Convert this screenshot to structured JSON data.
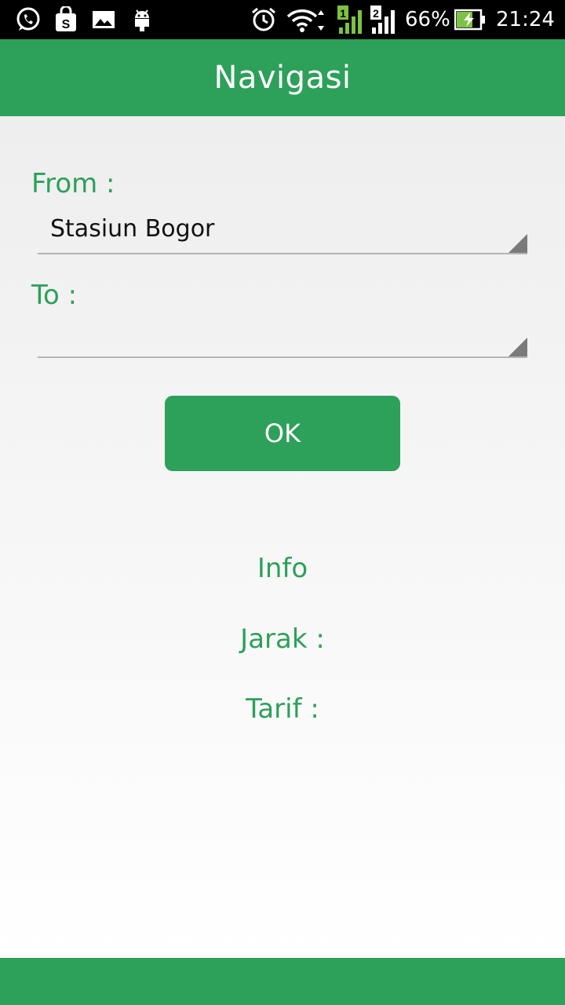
{
  "status_bar": {
    "battery": "66%",
    "time": "21:24",
    "sim1": "1",
    "sim2": "2",
    "icons": [
      "whatsapp-icon",
      "shopping-bag-icon",
      "gallery-icon",
      "android-icon",
      "alarm-icon",
      "wifi-icon",
      "signal-icon",
      "battery-charging-icon"
    ]
  },
  "app_bar": {
    "title": "Navigasi"
  },
  "form": {
    "from_label": "From :",
    "from_value": "Stasiun Bogor",
    "to_label": "To :",
    "to_value": "",
    "ok_label": "OK"
  },
  "info": {
    "heading": "Info",
    "distance_label": "Jarak :",
    "fare_label": "Tarif :"
  },
  "colors": {
    "accent": "#2da05a",
    "status_bar": "#000000"
  }
}
